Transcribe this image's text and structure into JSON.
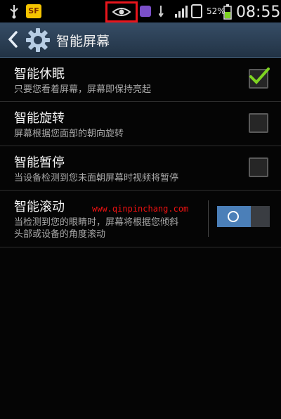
{
  "status_bar": {
    "battery_percent": "52%",
    "time": "08:55",
    "badge_text": "SF",
    "icons": [
      "usb-icon",
      "app-badge-icon",
      "smart-stay-eye-icon",
      "home-icon",
      "signal-icon",
      "battery-icon"
    ],
    "highlight_color": "#e8151c"
  },
  "header": {
    "title": "智能屏幕",
    "icons": [
      "back-arrow-icon",
      "gear-icon"
    ]
  },
  "settings": [
    {
      "title": "智能休眠",
      "subtitle": "只要您看着屏幕，屏幕即保持亮起",
      "control": "checkbox",
      "checked": true
    },
    {
      "title": "智能旋转",
      "subtitle": "屏幕根据您面部的朝向旋转",
      "control": "checkbox",
      "checked": false
    },
    {
      "title": "智能暂停",
      "subtitle": "当设备检测到您未面朝屏幕时视频将暂停",
      "control": "checkbox",
      "checked": false
    },
    {
      "title": "智能滚动",
      "subtitle_line1": "当检测到您的眼睛时，屏幕将根据您倾斜",
      "subtitle_line2": "头部或设备的角度滚动",
      "control": "toggle",
      "on": true
    }
  ],
  "watermark": "www.qinpinchang.com",
  "colors": {
    "accent_green": "#7ed321",
    "toggle_on": "#4b7fb8"
  }
}
